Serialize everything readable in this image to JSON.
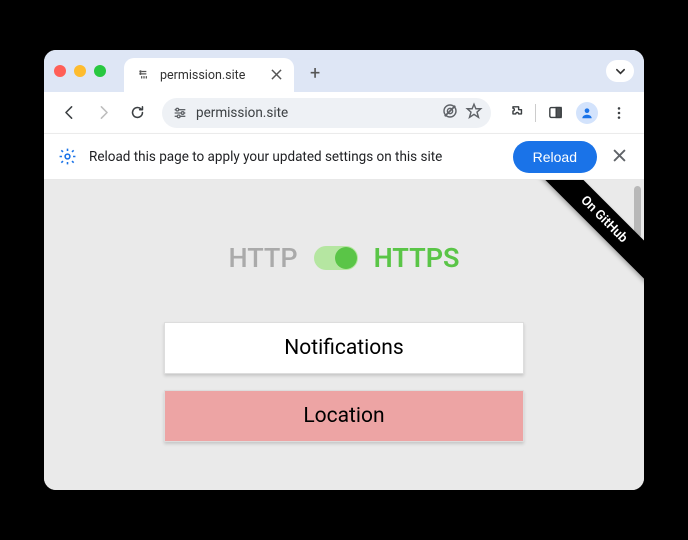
{
  "tab": {
    "title": "permission.site"
  },
  "omnibox": {
    "url": "permission.site"
  },
  "infobar": {
    "text": "Reload this page to apply your updated settings on this site",
    "reload_label": "Reload"
  },
  "ribbon": {
    "label": "On GitHub"
  },
  "protocol": {
    "http_label": "HTTP",
    "https_label": "HTTPS",
    "state": "https"
  },
  "buttons": {
    "notifications": "Notifications",
    "location": "Location"
  }
}
